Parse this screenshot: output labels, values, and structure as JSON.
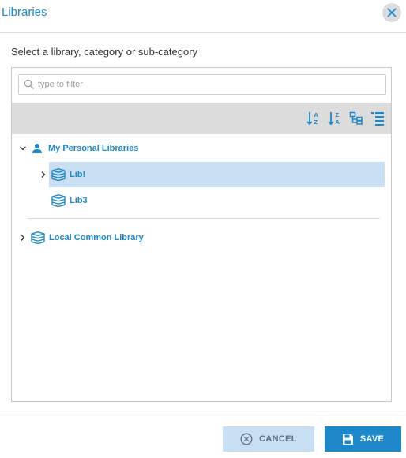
{
  "dialog": {
    "title": "Libraries",
    "close_icon": "close-icon"
  },
  "instruction": "Select a library, category or sub-category",
  "search": {
    "placeholder": "type to filter",
    "value": "",
    "icon": "search-icon"
  },
  "toolbar": {
    "tools": [
      {
        "icon": "sort-az-icon"
      },
      {
        "icon": "sort-za-icon"
      },
      {
        "icon": "tree-view-icon"
      },
      {
        "icon": "list-view-icon"
      }
    ]
  },
  "tree": {
    "personal": {
      "label": "My Personal Libraries",
      "icon": "user-icon",
      "expanded": true,
      "children": [
        {
          "label": "Lib!",
          "icon": "library-stack-icon",
          "selected": true,
          "has_children": true
        },
        {
          "label": "Lib3",
          "icon": "library-stack-icon",
          "selected": false,
          "has_children": false
        }
      ]
    },
    "common": {
      "label": "Local Common Library",
      "icon": "library-stack-icon",
      "expanded": false
    }
  },
  "footer": {
    "cancel_label": "CANCEL",
    "save_label": "SAVE"
  },
  "colors": {
    "accent": "#1e88c9",
    "selection": "#c9dff3",
    "toolbar_bg": "#dcdcdc"
  }
}
